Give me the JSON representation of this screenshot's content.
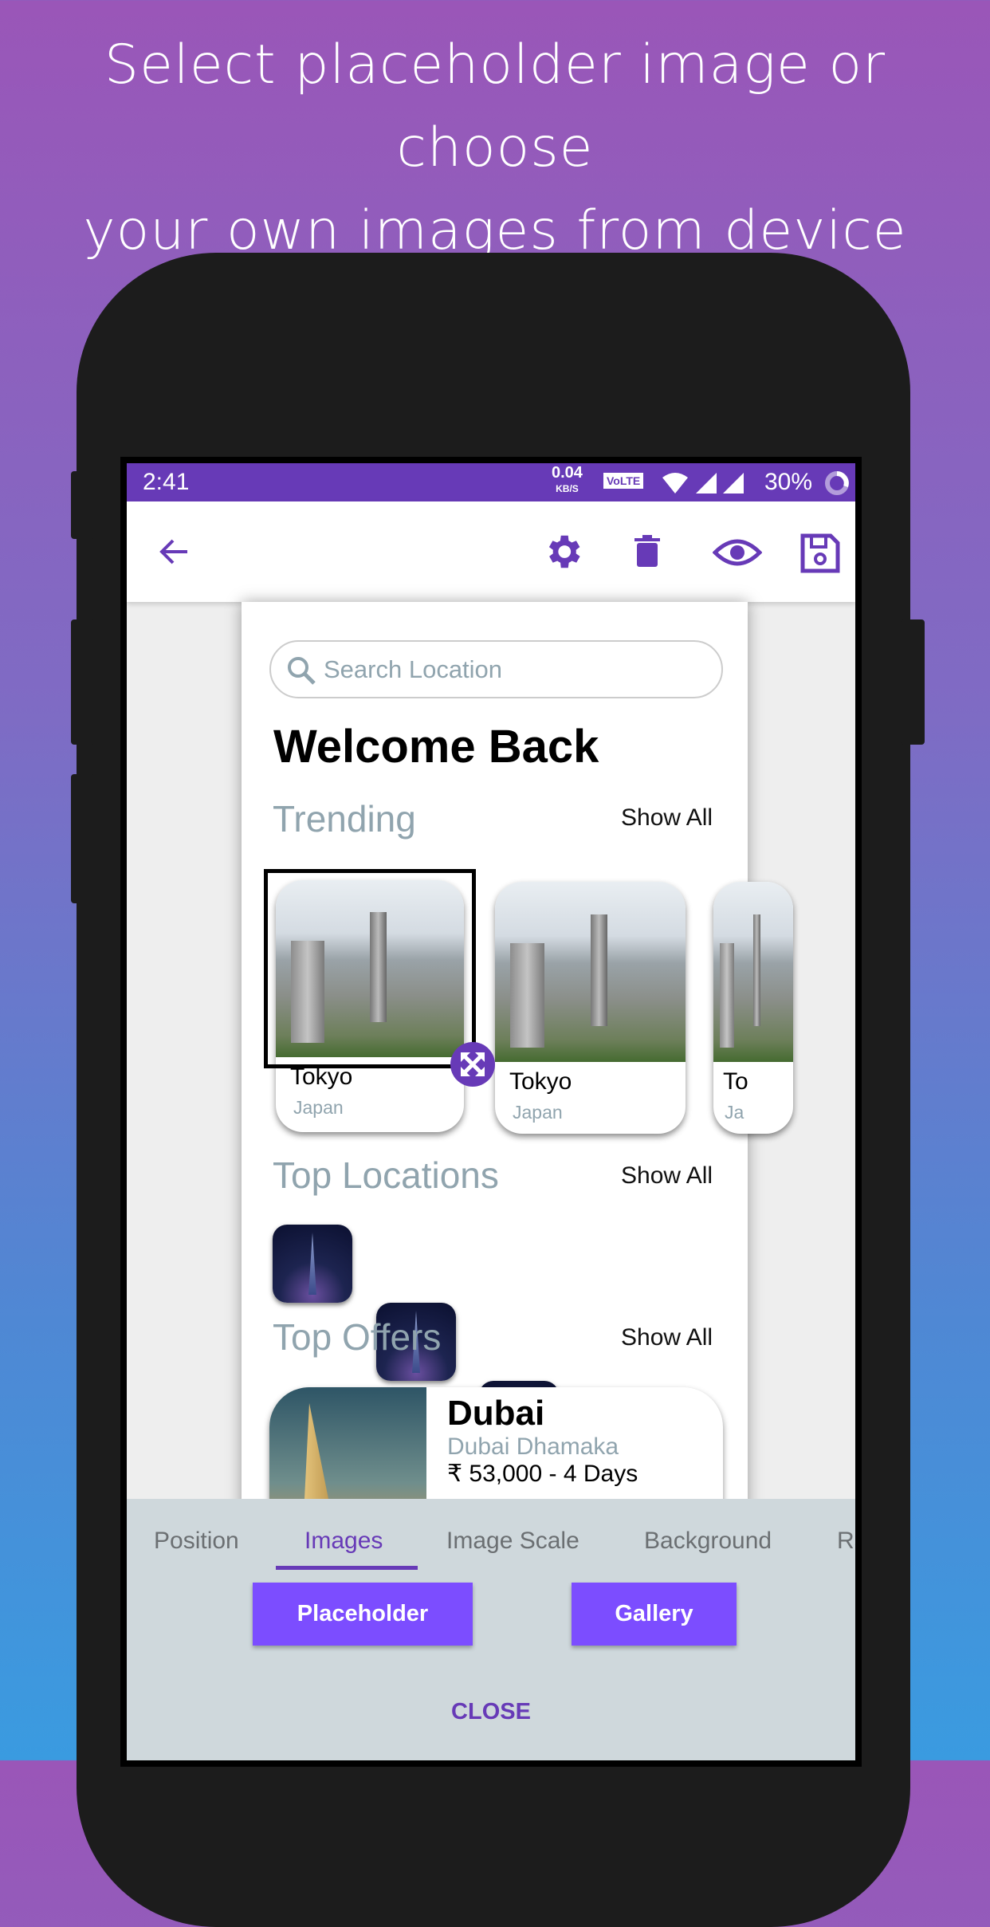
{
  "headline": {
    "line1": "Select placeholder image or choose",
    "line2": "your own images from device"
  },
  "status_bar": {
    "time": "2:41",
    "net_speed": "0.04",
    "net_unit": "KB/S",
    "volte": "VoLTE",
    "battery": "30%"
  },
  "toolbar": {
    "icons": [
      "arrow-back-icon",
      "gear-icon",
      "trash-icon",
      "eye-icon",
      "save-icon"
    ],
    "accent": "#673ab7"
  },
  "page": {
    "search_placeholder": "Search Location",
    "title": "Welcome Back",
    "trending": {
      "label": "Trending",
      "show_all": "Show All",
      "cards": [
        {
          "city": "Tokyo",
          "country": "Japan"
        },
        {
          "city": "Tokyo",
          "country": "Japan"
        },
        {
          "city": "To",
          "country": "Ja"
        }
      ]
    },
    "top_locations": {
      "label": "Top Locations",
      "show_all": "Show All"
    },
    "top_offers": {
      "label": "Top Offers",
      "show_all": "Show All",
      "offer": {
        "city": "Dubai",
        "name": "Dubai Dhamaka",
        "price": "₹ 53,000 - 4 Days"
      }
    }
  },
  "sheet": {
    "tabs": [
      {
        "label": "Position"
      },
      {
        "label": "Images",
        "active": true
      },
      {
        "label": "Image Scale"
      },
      {
        "label": "Background"
      },
      {
        "label": "Ra"
      }
    ],
    "placeholder_button": "Placeholder",
    "gallery_button": "Gallery",
    "close": "CLOSE",
    "button_color": "#7c4dff"
  }
}
